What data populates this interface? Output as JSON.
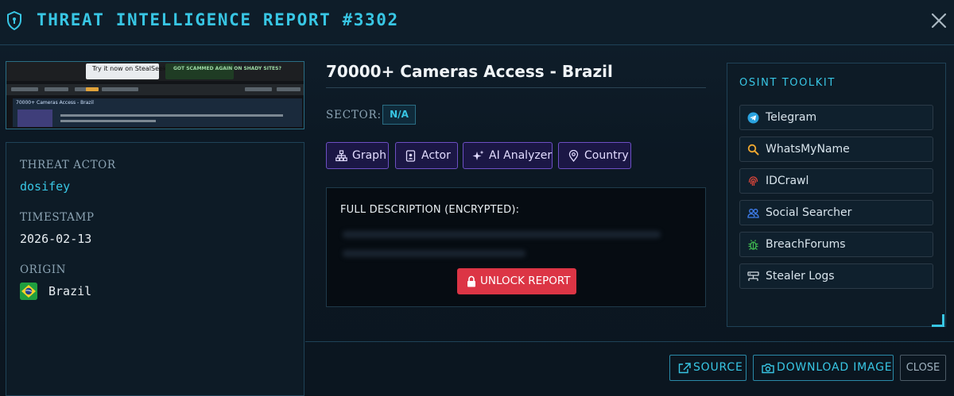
{
  "header": {
    "title": "THREAT INTELLIGENCE REPORT #3302",
    "icon": "shield-icon",
    "close_icon": "close-icon"
  },
  "preview": {
    "ad_text": "Try it now on StealSeek.io",
    "ad2_text": "GOT SCAMMED AGAIN ON SHADY SITES?",
    "post_title": "70000+ Cameras Access - Brazil"
  },
  "details": {
    "threat_actor_label": "THREAT ACTOR",
    "threat_actor": "dosifey",
    "timestamp_label": "TIMESTAMP",
    "timestamp": "2026-02-13",
    "origin_label": "ORIGIN",
    "origin": "Brazil",
    "origin_flag": "brazil-flag-icon"
  },
  "report": {
    "title": "70000+ Cameras Access - Brazil",
    "sector_label": "SECTOR:",
    "sector": "N/A",
    "actions": [
      {
        "label": "Graph",
        "icon": "graph-icon"
      },
      {
        "label": "Actor",
        "icon": "id-badge-icon"
      },
      {
        "label": "AI Analyzer",
        "icon": "sparkles-icon"
      },
      {
        "label": "Country",
        "icon": "location-pin-icon"
      }
    ],
    "description_label": "FULL DESCRIPTION (ENCRYPTED):",
    "unlock_label": "UNLOCK REPORT"
  },
  "toolkit": {
    "title": "OSINT TOOLKIT",
    "items": [
      {
        "label": "Telegram",
        "icon": "telegram-icon"
      },
      {
        "label": "WhatsMyName",
        "icon": "search-icon"
      },
      {
        "label": "IDCrawl",
        "icon": "fingerprint-icon"
      },
      {
        "label": "Social Searcher",
        "icon": "users-icon"
      },
      {
        "label": "BreachForums",
        "icon": "bug-icon"
      },
      {
        "label": "Stealer Logs",
        "icon": "server-icon"
      }
    ]
  },
  "footer": {
    "source_label": "SOURCE",
    "download_label": "DOWNLOAD IMAGE",
    "close_label": "CLOSE"
  },
  "colors": {
    "accent": "#38c6e4",
    "action_border": "#6d4fc4",
    "danger": "#dc3545",
    "background": "#0b1620"
  }
}
